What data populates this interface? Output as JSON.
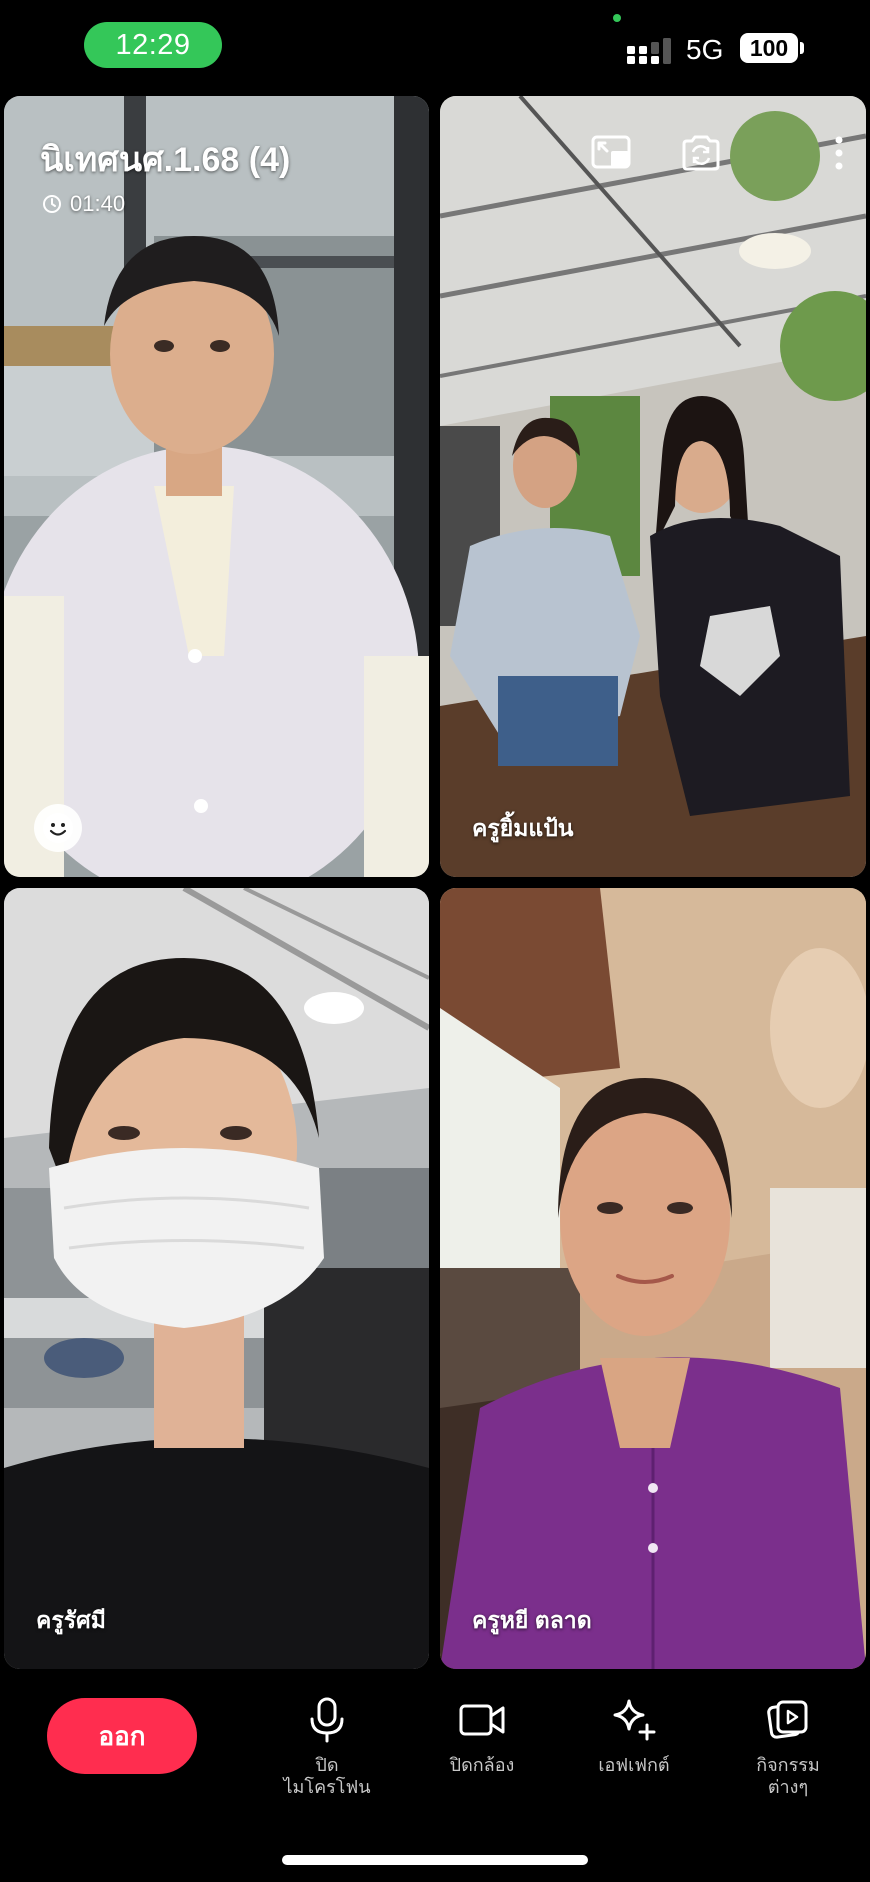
{
  "status_bar": {
    "time": "12:29",
    "network": "5G",
    "battery": "100"
  },
  "call": {
    "title": "นิเทศนศ.1.68 (4)",
    "duration": "01:40"
  },
  "participants": [
    {
      "name": ""
    },
    {
      "name": "ครูยิ้มแป้น"
    },
    {
      "name": "ครูรัศมี"
    },
    {
      "name": "ครูหยี ตลาด"
    }
  ],
  "controls": {
    "leave_label": "ออก",
    "mic_label": "ปิด\nไมโครโฟน",
    "camera_label": "ปิดกล้อง",
    "effects_label": "เอฟเฟกต์",
    "activities_label": "กิจกรรม\nต่างๆ"
  },
  "icons": [
    "clock-icon",
    "smiley-icon",
    "picture-in-picture-icon",
    "switch-camera-icon",
    "more-options-icon",
    "microphone-icon",
    "video-camera-icon",
    "sparkle-icon",
    "activities-icon"
  ],
  "colors": {
    "time_pill": "#34c759",
    "leave_button": "#ff2d4f",
    "background": "#000000"
  }
}
